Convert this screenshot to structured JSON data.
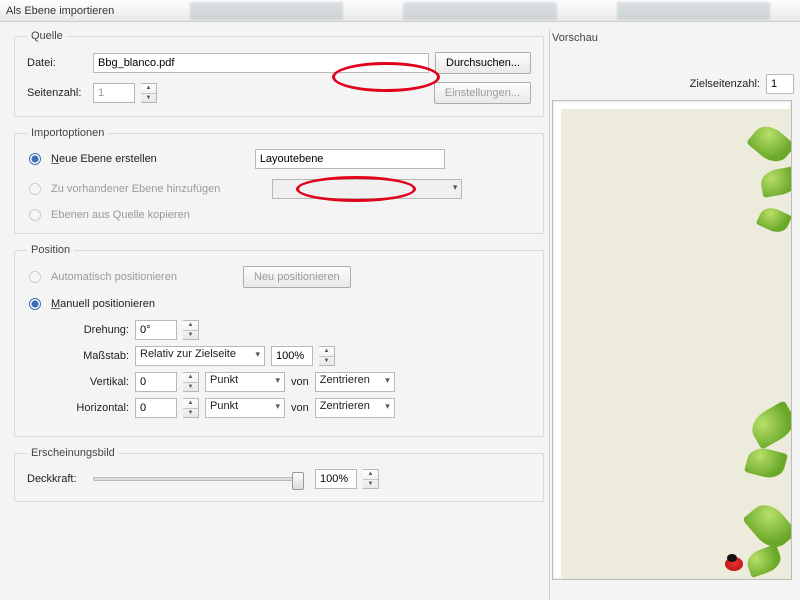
{
  "title": "Als Ebene importieren",
  "source": {
    "legend": "Quelle",
    "file_label": "Datei:",
    "file_value": "Bbg_blanco.pdf",
    "browse": "Durchsuchen...",
    "pagecount_label": "Seitenzahl:",
    "pagecount_value": "1",
    "settings": "Einstellungen..."
  },
  "importopts": {
    "legend": "Importoptionen",
    "new_layer_label": "Neue Ebene erstellen",
    "new_layer_name": "Layoutebene",
    "add_existing": "Zu vorhandener Ebene hinzufügen",
    "copy_from_source": "Ebenen aus Quelle kopieren"
  },
  "position": {
    "legend": "Position",
    "auto": "Automatisch positionieren",
    "repos": "Neu positionieren",
    "manual": "Manuell positionieren",
    "rotation_label": "Drehung:",
    "rotation_value": "0°",
    "scale_label": "Maßstab:",
    "scale_mode": "Relativ zur Zielseite",
    "scale_value": "100%",
    "vertical_label": "Vertikal:",
    "vertical_offset": "0",
    "vertical_unit": "Punkt",
    "from": "von",
    "vertical_anchor": "Zentrieren",
    "horizontal_label": "Horizontal:",
    "horizontal_offset": "0",
    "horizontal_unit": "Punkt",
    "horizontal_anchor": "Zentrieren"
  },
  "appearance": {
    "legend": "Erscheinungsbild",
    "opacity_label": "Deckkraft:",
    "opacity_value": "100%"
  },
  "preview": {
    "legend": "Vorschau",
    "target_page_label": "Zielseitenzahl:",
    "target_page_value": "1"
  }
}
